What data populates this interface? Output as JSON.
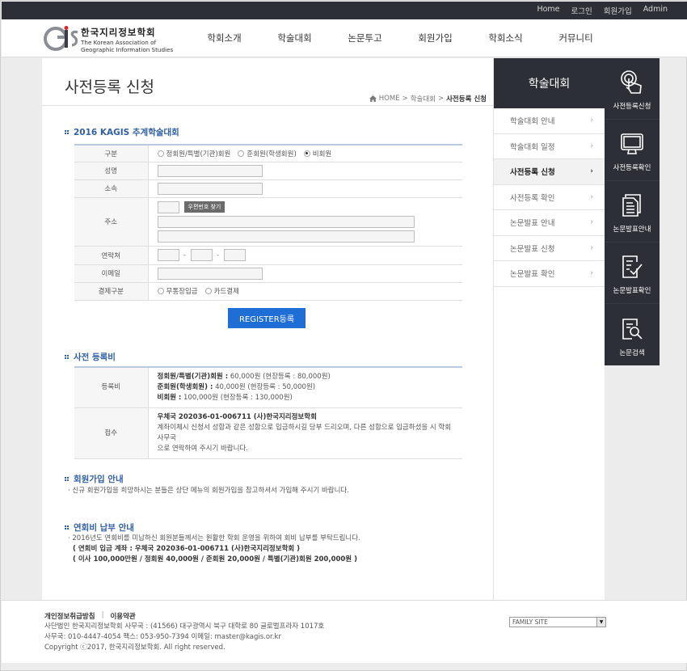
{
  "topbar": {
    "links": [
      "Home",
      "로그인",
      "회원가입",
      "Admin"
    ]
  },
  "logo": {
    "mark": "GIS",
    "name_kr": "한국지리정보학회",
    "name_en_1": "The Korean Association of",
    "name_en_2": "Geographic Information Studies"
  },
  "gnb": [
    "학회소개",
    "학술대회",
    "논문투고",
    "회원가입",
    "학회소식",
    "커뮤니티"
  ],
  "page": {
    "title": "사전등록 신청",
    "breadcrumb": {
      "home": "HOME",
      "sep1": ">",
      "parent": "학술대회",
      "sep2": ">",
      "current": "사전등록 신청"
    }
  },
  "form": {
    "section_title": "2016 KAGIS 추계학술대회",
    "labels": {
      "type": "구분",
      "name": "성명",
      "affiliation": "소속",
      "address": "주소",
      "phone": "연락처",
      "email": "이메일",
      "payment": "결제구분"
    },
    "type_options": [
      "정회원/특별(기관)회원",
      "준회원(학생회원)",
      "비회원"
    ],
    "type_selected": "비회원",
    "zip_button": "우편번호 찾기",
    "phone_sep": "-",
    "payment_options": [
      "무통장입금",
      "카드결제"
    ],
    "submit": "REGISTER등록"
  },
  "fee": {
    "section_title": "사전 등록비",
    "labels": {
      "fee": "등록비",
      "receipt": "접수"
    },
    "fee_lines": [
      {
        "strong": "정회원/특별(기관)회원 :",
        "text": " 60,000원 (현장등록 : 80,000원)"
      },
      {
        "strong": "준회원(학생회원) :",
        "text": " 40,000원 (현장등록 : 50,000원)"
      },
      {
        "strong": "비회원 :",
        "text": " 100,000원 (현장등록 : 130,000원)"
      }
    ],
    "account": "우체국 202036-01-006711 (사)한국지리정보학회",
    "receipt_1": "계좌이체시 신청서 성함과 같은 성함으로 입금하시길 당부 드리오며, 다른 성함으로 입금하셨을 시 학회 사무국",
    "receipt_2": "으로 연락하여 주시기 바랍니다."
  },
  "membership": {
    "section_title": "회원가입 안내",
    "text": "· 신규 회원가입을 희망하시는 분들은 상단 메뉴의 회원가입을 참고하셔서 가입해 주시기 바랍니다."
  },
  "dues": {
    "section_title": "연회비 납부 안내",
    "text": "· 2016년도 연회비를 미납하신 회원분들께서는 원활한 학회 운영을 위하여 회비 납부를 부탁드립니다.",
    "account": "( 연회비 입금 계좌 : 우체국 202036-01-006711 (사)한국지리정보학회 )",
    "amounts": "( 이사 100,000만원 / 정회원 40,000원 / 준회원 20,000원 / 특별(기관)회원 200,000원 )"
  },
  "snb": {
    "title": "학술대회",
    "items": [
      "학술대회 안내",
      "학술대회 일정",
      "사전등록 신청",
      "사전등록 확인",
      "논문발표 안내",
      "논문발표 신청",
      "논문발표 확인"
    ],
    "active": "사전등록 신청",
    "arrow": "›"
  },
  "quick": [
    {
      "label": "사전등록신청",
      "icon": "touch-icon"
    },
    {
      "label": "사전등록확인",
      "icon": "monitor-icon"
    },
    {
      "label": "논문발표안내",
      "icon": "document-icon"
    },
    {
      "label": "논문발표확인",
      "icon": "checklist-icon"
    },
    {
      "label": "논문검색",
      "icon": "search-document-icon"
    }
  ],
  "footer": {
    "privacy": "개인정보취급방침",
    "divider": "|",
    "terms": "이용약관",
    "address": "사단법인 한국지리정보학회 사무국 : (41566) 대구광역시 북구 대학로 80 글로벌프라자 1017호",
    "contact": "사무국: 010-4447-4054 팩스: 053-950-7394 이메일: master@kagis.or.kr",
    "copyright": "Copyright ⓒ2017, 한국지리정보학회. All right reserved.",
    "family_site": "FAMILY SITE",
    "family_caret": "▼"
  },
  "colors": {
    "dark": "#2d2f36",
    "accent": "#1f6ed6",
    "section": "#2f5fa8"
  }
}
